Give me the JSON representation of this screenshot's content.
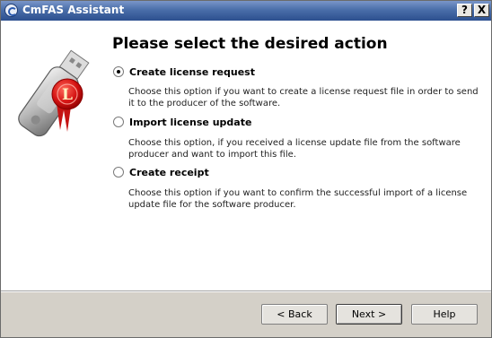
{
  "window": {
    "title": "CmFAS Assistant",
    "help_glyph": "?",
    "close_glyph": "X"
  },
  "main": {
    "heading": "Please select the desired action",
    "options": [
      {
        "label": "Create license request",
        "description": "Choose this option if you want to create a license request file in order to send it to the producer of the software.",
        "selected": true
      },
      {
        "label": "Import license update",
        "description": "Choose this option, if you received a license update file from the software producer and want to import this file.",
        "selected": false
      },
      {
        "label": "Create receipt",
        "description": "Choose this option if you want to confirm the successful import of a license update file for the software producer.",
        "selected": false
      }
    ],
    "logo_letter": "L"
  },
  "footer": {
    "back_label": "< Back",
    "next_label": "Next >",
    "help_label": "Help"
  }
}
